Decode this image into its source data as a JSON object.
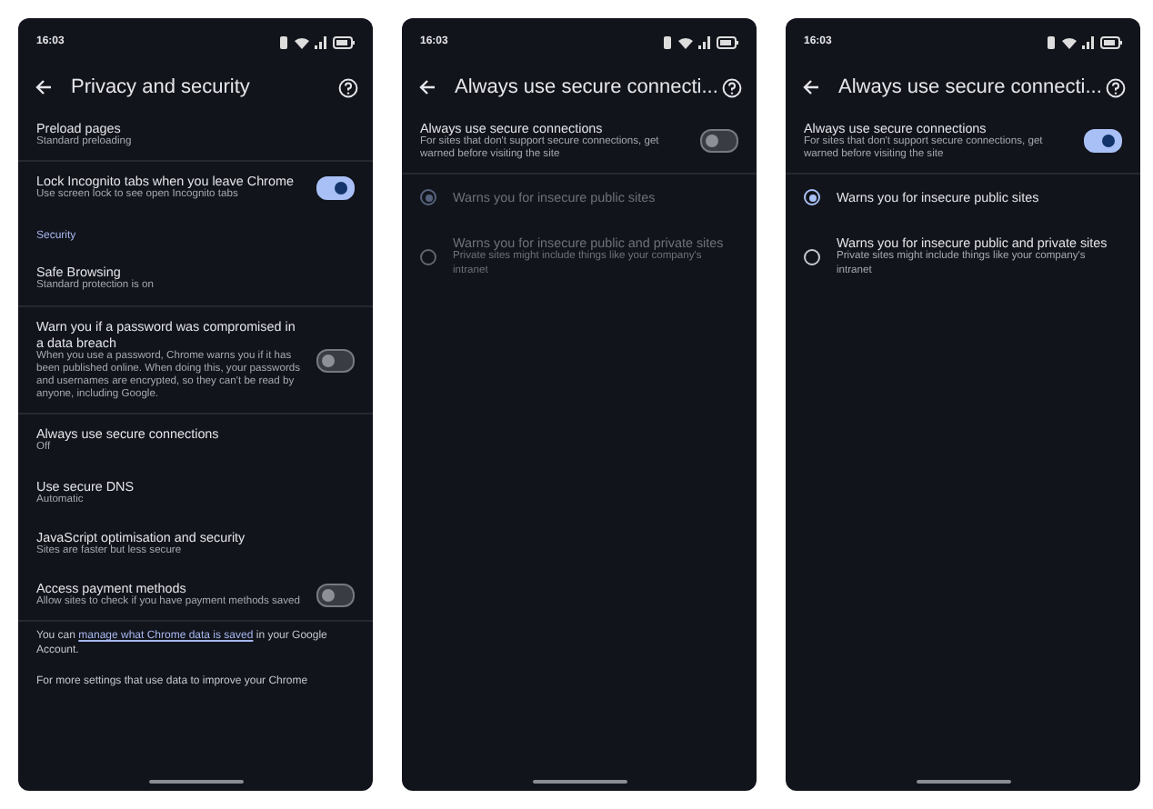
{
  "phones": [
    {
      "status_time": "16:03",
      "title": "Privacy and security",
      "items": [
        {
          "kind": "setting",
          "title": "Preload pages",
          "subtitle": "Standard preloading",
          "divider": true
        },
        {
          "kind": "toggle",
          "title": "Lock Incognito tabs when you leave Chrome",
          "subtitle": "Use screen lock to see open Incognito tabs",
          "on": true
        },
        {
          "kind": "header",
          "title": "Security"
        },
        {
          "kind": "setting",
          "title": "Safe Browsing",
          "subtitle": "Standard protection is on",
          "divider": true
        },
        {
          "kind": "toggle",
          "title": "Warn you if a password was compromised in a data breach",
          "subtitle": "When you use a password, Chrome warns you if it has been published online. When doing this, your passwords and usernames are encrypted, so they can't be read by anyone, including Google.",
          "on": false,
          "divider": true
        },
        {
          "kind": "setting",
          "title": "Always use secure connections",
          "subtitle": "Off"
        },
        {
          "kind": "setting",
          "title": "Use secure DNS",
          "subtitle": "Automatic"
        },
        {
          "kind": "setting",
          "title": "JavaScript optimisation and security",
          "subtitle": "Sites are faster but less secure"
        },
        {
          "kind": "toggle",
          "title": "Access payment methods",
          "subtitle": "Allow sites to check if you have payment methods saved",
          "on": false,
          "divider": true
        },
        {
          "kind": "footer",
          "before": "You can ",
          "link": "manage what Chrome data is saved",
          "after": " in your Google Account."
        },
        {
          "kind": "note",
          "title": "For more settings that use data to improve your Chrome"
        }
      ]
    },
    {
      "status_time": "16:03",
      "title": "Always use secure connecti...",
      "items": [
        {
          "kind": "toggle",
          "title": "Always use secure connections",
          "subtitle": "For sites that don't support secure connections, get warned before visiting the site",
          "on": false,
          "divider": true
        },
        {
          "kind": "radio",
          "title": "Warns you for insecure public sites",
          "selected": true,
          "disabled": true
        },
        {
          "kind": "radio",
          "title": "Warns you for insecure public and private sites",
          "subtitle": "Private sites might include things like your company's intranet",
          "selected": false,
          "disabled": true
        }
      ]
    },
    {
      "status_time": "16:03",
      "title": "Always use secure connecti...",
      "items": [
        {
          "kind": "toggle",
          "title": "Always use secure connections",
          "subtitle": "For sites that don't support secure connections, get warned before visiting the site",
          "on": true,
          "divider": true
        },
        {
          "kind": "radio",
          "title": "Warns you for insecure public sites",
          "selected": true,
          "disabled": false
        },
        {
          "kind": "radio",
          "title": "Warns you for insecure public and private sites",
          "subtitle": "Private sites might include things like your company's intranet",
          "selected": false,
          "disabled": false
        }
      ]
    }
  ]
}
